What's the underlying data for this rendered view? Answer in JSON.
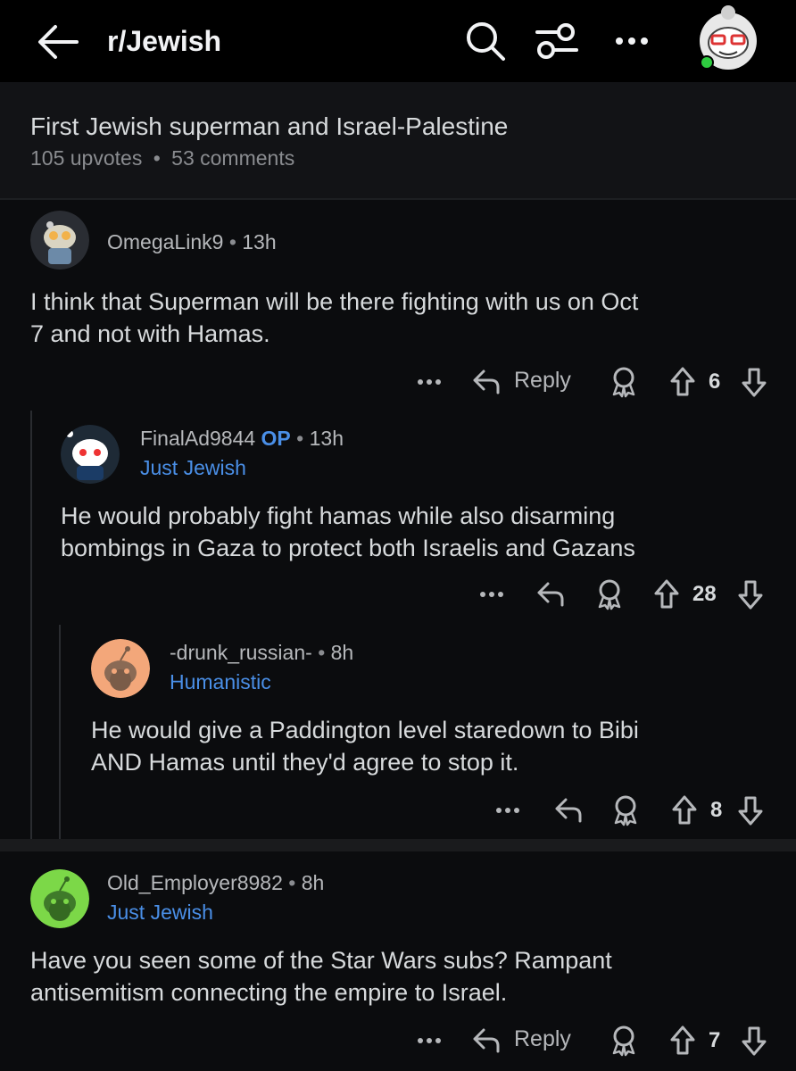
{
  "header": {
    "subreddit": "r/Jewish"
  },
  "post": {
    "title": "First Jewish superman and Israel-Palestine",
    "upvotes": "105 upvotes",
    "comments": "53 comments",
    "sep": "•"
  },
  "comments": [
    {
      "username": "OmegaLink9",
      "time": "13h",
      "text_line1": "I think that Superman will be there fighting with us on Oct",
      "text_line2": "7 and not with Hamas.",
      "reply_label": "Reply",
      "votes": "6"
    },
    {
      "username": "FinalAd9844",
      "op_badge": "OP",
      "time": "13h",
      "flair": "Just Jewish",
      "text_line1": "He would probably fight hamas while also disarming",
      "text_line2": "bombings in Gaza to protect both Israelis and Gazans",
      "votes": "28"
    },
    {
      "username": "-drunk_russian-",
      "time": "8h",
      "flair": "Humanistic",
      "text_line1": "He would give a Paddington level staredown to Bibi",
      "text_line2": "AND Hamas until they'd agree to stop it.",
      "votes": "8"
    },
    {
      "username": "Old_Employer8982",
      "time": "8h",
      "flair": "Just Jewish",
      "text_line1": "Have you seen some of the Star Wars subs? Rampant",
      "text_line2": "antisemitism connecting the empire to Israel.",
      "reply_label": "Reply",
      "votes": "7"
    }
  ],
  "icons": {
    "back": "arrow-left-icon",
    "search": "search-icon",
    "filter": "sliders-icon",
    "more": "more-horizontal-icon",
    "award": "award-icon",
    "upvote": "arrow-up-icon",
    "downvote": "arrow-down-icon",
    "reply": "reply-icon"
  },
  "colors": {
    "background": "#0b0c0e",
    "text": "#d7dadc",
    "muted": "#8a8c90",
    "flair": "#4a8fe7",
    "online": "#2ecc40"
  }
}
